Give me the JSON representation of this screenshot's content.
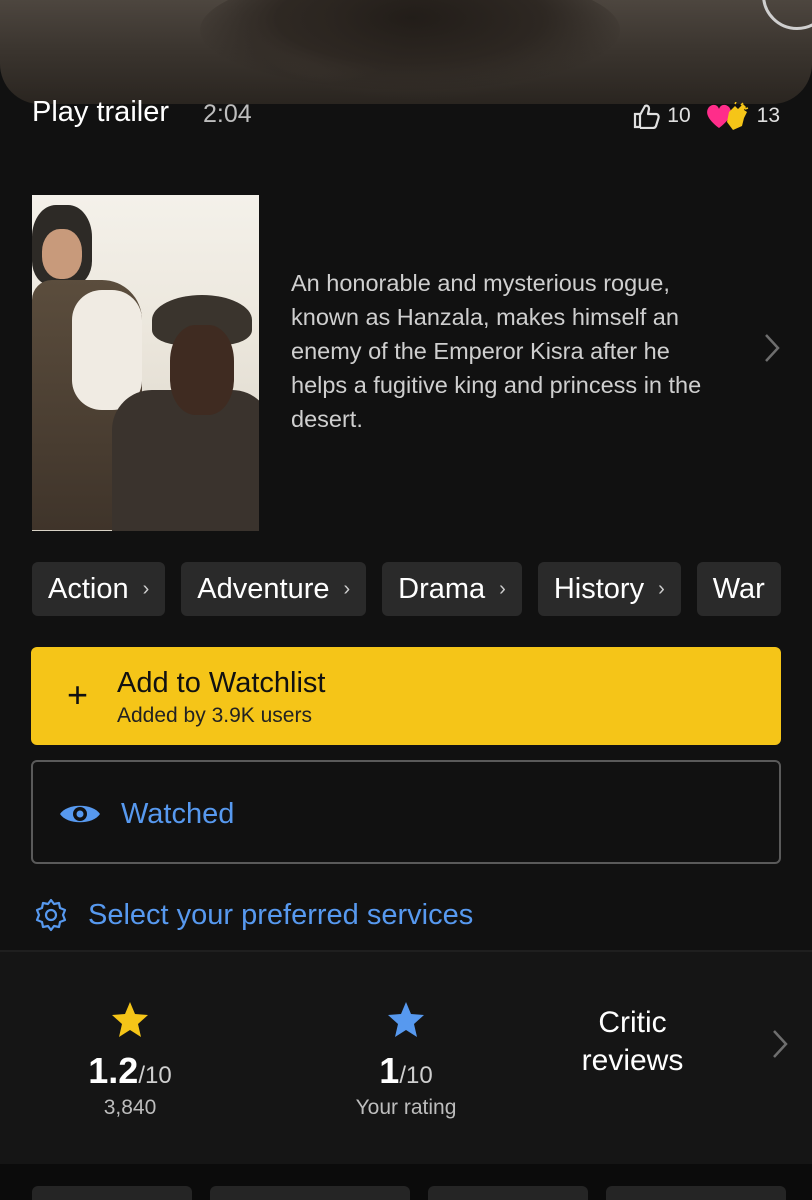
{
  "trailer": {
    "label": "Play trailer",
    "duration": "2:04",
    "likes": "10",
    "loves": "13"
  },
  "title": {
    "description": "An honorable and mysterious rogue, known as Hanzala, makes himself an enemy of the Emperor Kisra after he helps a fugitive king and princess in the desert."
  },
  "genres": [
    {
      "label": "Action"
    },
    {
      "label": "Adventure"
    },
    {
      "label": "Drama"
    },
    {
      "label": "History"
    },
    {
      "label": "War"
    }
  ],
  "watchlist": {
    "title": "Add to Watchlist",
    "subtitle": "Added by 3.9K users",
    "color": "#f5c518"
  },
  "watched": {
    "label": "Watched",
    "color": "#5799ef"
  },
  "services": {
    "label": "Select your preferred services"
  },
  "ratings": {
    "imdb": {
      "value": "1.2",
      "out_of": "/10",
      "count": "3,840",
      "star_color": "#f5c518"
    },
    "user": {
      "value": "1",
      "out_of": "/10",
      "label": "Your rating",
      "star_color": "#5799ef"
    },
    "critic": {
      "label": "Critic reviews"
    }
  },
  "icons": {
    "like": "thumbs-up-icon",
    "love": "heart-clap-icon",
    "chevron": "chevron-right-icon",
    "eye": "eye-icon",
    "gear": "gear-icon",
    "star": "star-icon"
  }
}
